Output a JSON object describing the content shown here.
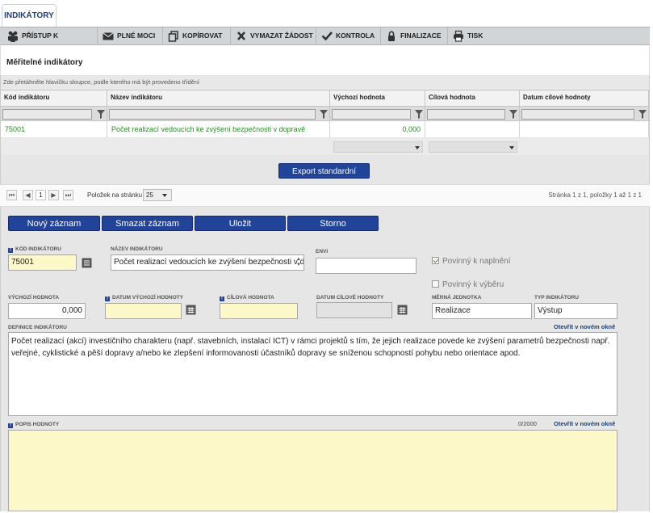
{
  "tabs": [
    {
      "label": "INDIKÁTORY"
    }
  ],
  "toolbar": {
    "access": "PŘÍSTUP K PROJEKTU",
    "power": "PLNÉ MOCI",
    "copy": "KOPÍROVAT",
    "delete": "VYMAZAT ŽÁDOST",
    "check": "KONTROLA",
    "finalize": "FINALIZACE",
    "print": "TISK"
  },
  "section_title": "Měřitelné indikátory",
  "grid": {
    "group_hint": "Zde přetáhněte hlavičku sloupce, podle kterého má být provedeno třídění",
    "columns": [
      "Kód indikátoru",
      "Název indikátoru",
      "Výchozí hodnota",
      "Cílová hodnota",
      "Datum cílové hodnoty"
    ],
    "rows": [
      {
        "code": "75001",
        "name": "Počet realizací vedoucích ke zvýšení bezpečnosti v dopravě",
        "start": "0,000",
        "target": "",
        "date": ""
      }
    ]
  },
  "export_label": "Export standardní",
  "pager": {
    "current_page": "1",
    "page_size_label": "Položek na stránku",
    "page_size": "25",
    "summary": "Stránka 1 z 1, položky 1 až 1 z 1"
  },
  "buttons": {
    "new": "Nový záznam",
    "delete": "Smazat záznam",
    "save": "Uložit",
    "cancel": "Storno"
  },
  "form": {
    "code_label": "KÓD INDIKÁTORU",
    "code_value": "75001",
    "name_label": "NÁZEV INDIKÁTORU",
    "name_value": "Počet realizací vedoucích ke zvýšení bezpečnosti v dopravě",
    "envi_label": "ENVI",
    "envi_value": "",
    "povinny_naplneni": "Povinný k naplnění",
    "povinny_naplneni_checked": true,
    "povinny_vyberu": "Povinný k výběru",
    "povinny_vyberu_checked": false,
    "start_label": "VÝCHOZÍ HODNOTA",
    "start_value": "0,000",
    "start_date_label": "DATUM VÝCHOZÍ HODNOTY",
    "start_date_value": "",
    "target_label": "CÍLOVÁ HODNOTA",
    "target_value": "",
    "target_date_label": "DATUM CÍLOVÉ HODNOTY",
    "target_date_value": "",
    "unit_label": "MĚRNÁ JEDNOTKA",
    "unit_value": "Realizace",
    "type_label": "TYP INDIKÁTORU",
    "type_value": "Výstup",
    "definition_label": "DEFINICE INDIKÁTORU",
    "definition_link": "Otevřít v novém okně",
    "definition_text": "Počet realizací (akcí) investičního charakteru (např. stavebních, instalací ICT) v rámci projektů s tím, že  jejich realizace povede ke zvýšení parametrů bezpečnosti např. veřejné, cyklistické a pěší dopravy a/nebo ke zlepšení informovanosti účastníků dopravy se sníženou schopností pohybu nebo orientace apod.",
    "description_label": "POPIS HODNOTY",
    "description_counter": "0/2000",
    "description_link": "Otevřít v novém okně",
    "description_value": ""
  },
  "colors": {
    "accent": "#21439a",
    "link": "#1d3f7a",
    "row_text": "#2a8a26",
    "required_bg": "#fcf8c8"
  }
}
